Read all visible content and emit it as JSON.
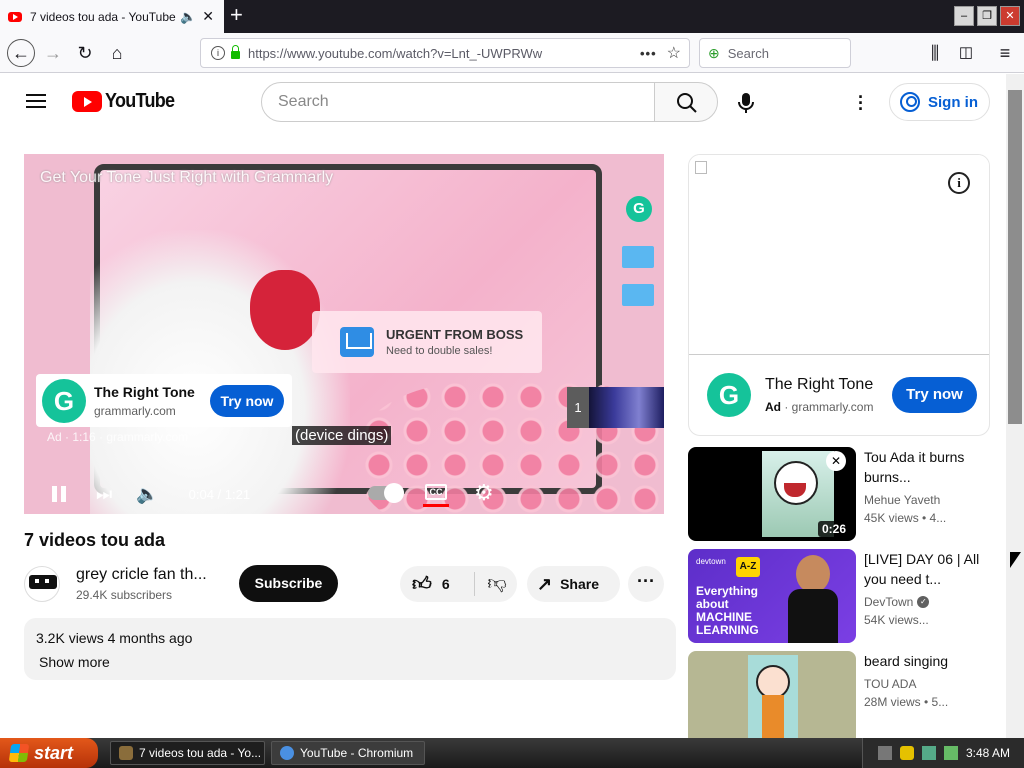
{
  "browser": {
    "tab_title": "7 videos tou ada - YouTube",
    "url": "https://www.youtube.com/watch?v=Lnt_-UWPRWw",
    "search_placeholder": "Search"
  },
  "youtube": {
    "logo_text": "YouTube",
    "search_placeholder": "Search",
    "sign_in": "Sign in",
    "player": {
      "ad_overlay_title": "Get Your Tone Just Right with Grammarly",
      "notification_title": "URGENT FROM BOSS",
      "notification_text": "Need to double sales!",
      "ad_card_title": "The Right Tone",
      "ad_card_domain": "grammarly.com",
      "ad_card_button": "Try now",
      "ad_meta": "Ad · 1:16 · grammarly.com",
      "caption": "(device dings)",
      "queue_count": "1",
      "time": "0:04 / 1:21",
      "cc_label": "CC",
      "grammarly_letter": "G"
    },
    "video_title": "7 videos tou ada",
    "channel": {
      "name": "grey cricle fan th...",
      "subscribers": "29.4K subscribers",
      "subscribe": "Subscribe"
    },
    "actions": {
      "likes": "6",
      "share": "Share"
    },
    "description": {
      "stats": "3.2K views  4 months ago",
      "show_more": "Show more"
    },
    "side_ad": {
      "title": "The Right Tone",
      "ad_label": "Ad",
      "domain": "grammarly.com",
      "button": "Try now",
      "info": "i"
    },
    "recommendations": [
      {
        "title": "Tou Ada it burns burns...",
        "channel": "Mehue Yaveth",
        "views": "45K views • 4...",
        "duration": "0:26"
      },
      {
        "title": "[LIVE] DAY 06 | All you need t...",
        "channel": "DevTown",
        "views": "54K views...",
        "thumb_text": "Everything about MACHINE LEARNING",
        "thumb_az": "A-Z",
        "thumb_brand": "devtown"
      },
      {
        "title": "beard singing",
        "channel": "TOU ADA",
        "views": "28M views • 5..."
      }
    ]
  },
  "taskbar": {
    "start": "start",
    "items": [
      "7 videos tou ada - Yo...",
      "YouTube - Chromium"
    ],
    "clock": "3:48 AM"
  },
  "colors": {
    "accent": "#065fd4",
    "youtube_red": "#ff0000",
    "grammarly": "#15c39a"
  }
}
